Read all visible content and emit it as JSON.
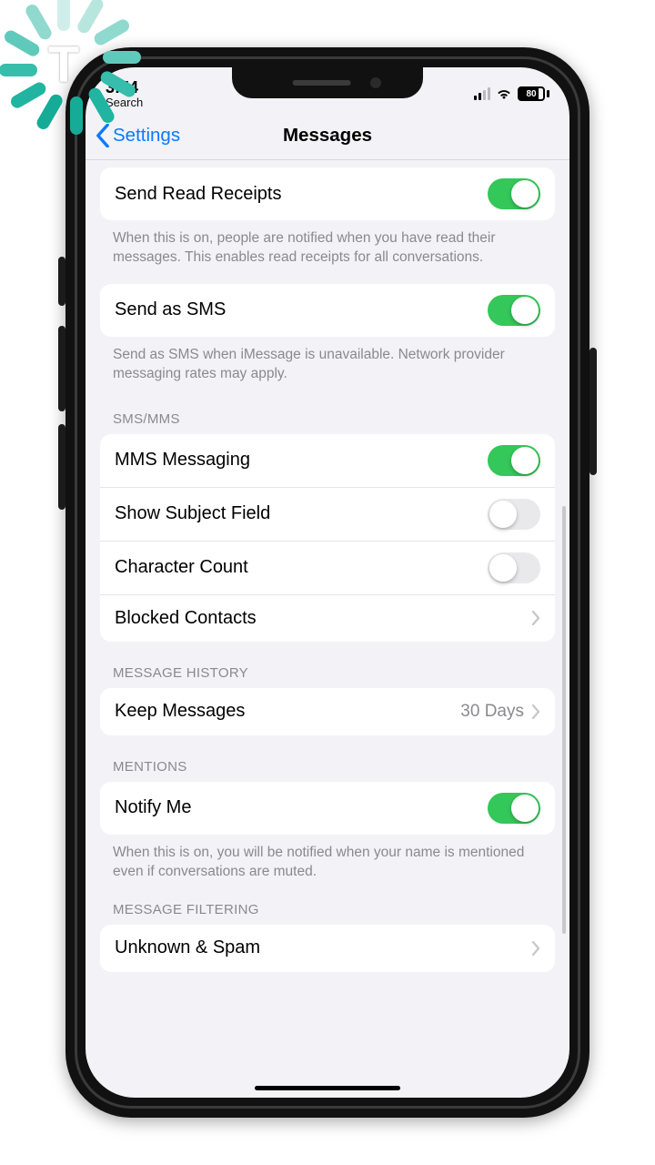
{
  "status": {
    "time": "3:54",
    "search": "Search",
    "battery": "80"
  },
  "nav": {
    "back": "Settings",
    "title": "Messages"
  },
  "sections": {
    "readReceipts": {
      "label": "Send Read Receipts",
      "note": "When this is on, people are notified when you have read their messages. This enables read receipts for all conversations.",
      "on": true
    },
    "sendSms": {
      "label": "Send as SMS",
      "note": "Send as SMS when iMessage is unavailable. Network provider messaging rates may apply.",
      "on": true
    },
    "smsHeader": "SMS/MMS",
    "mms": {
      "label": "MMS Messaging",
      "on": true
    },
    "subject": {
      "label": "Show Subject Field",
      "on": false
    },
    "charCount": {
      "label": "Character Count",
      "on": false
    },
    "blocked": {
      "label": "Blocked Contacts"
    },
    "historyHeader": "MESSAGE HISTORY",
    "keep": {
      "label": "Keep Messages",
      "value": "30 Days"
    },
    "mentionsHeader": "MENTIONS",
    "notify": {
      "label": "Notify Me",
      "note": "When this is on, you will be notified when your name is mentioned even if conversations are muted.",
      "on": true
    },
    "filterHeader": "MESSAGE FILTERING",
    "unknown": {
      "label": "Unknown & Spam"
    }
  }
}
